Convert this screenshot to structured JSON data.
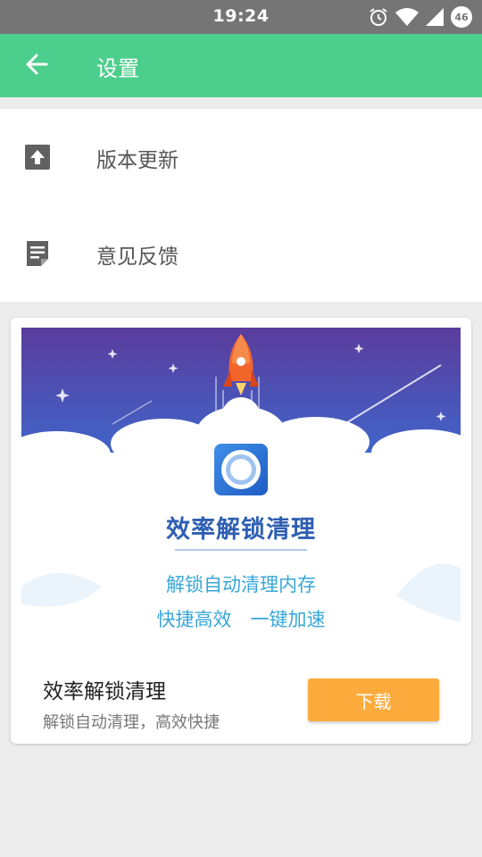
{
  "status_bar": {
    "time": "19:24",
    "icons": [
      "alarm-icon",
      "wifi-icon",
      "cellular-signal-icon",
      "battery-icon"
    ],
    "battery_level": "46"
  },
  "app_bar": {
    "title": "设置",
    "back_icon": "arrow-left-icon",
    "color": "#4cce8c"
  },
  "settings": {
    "items": [
      {
        "label": "版本更新",
        "icon": "upload-icon"
      },
      {
        "label": "意见反馈",
        "icon": "feedback-note-icon"
      }
    ]
  },
  "ad_card": {
    "banner": {
      "title": "效率解锁清理",
      "line1": "解锁自动清理内存",
      "line2": "快捷高效　一键加速",
      "app_icon": "cleaner-app-icon",
      "decoration": "rocket-launch-icon"
    },
    "name": "效率解锁清理",
    "description": "解锁自动清理，高效快捷",
    "download_label": "下载",
    "download_color": "#fdab3c"
  }
}
